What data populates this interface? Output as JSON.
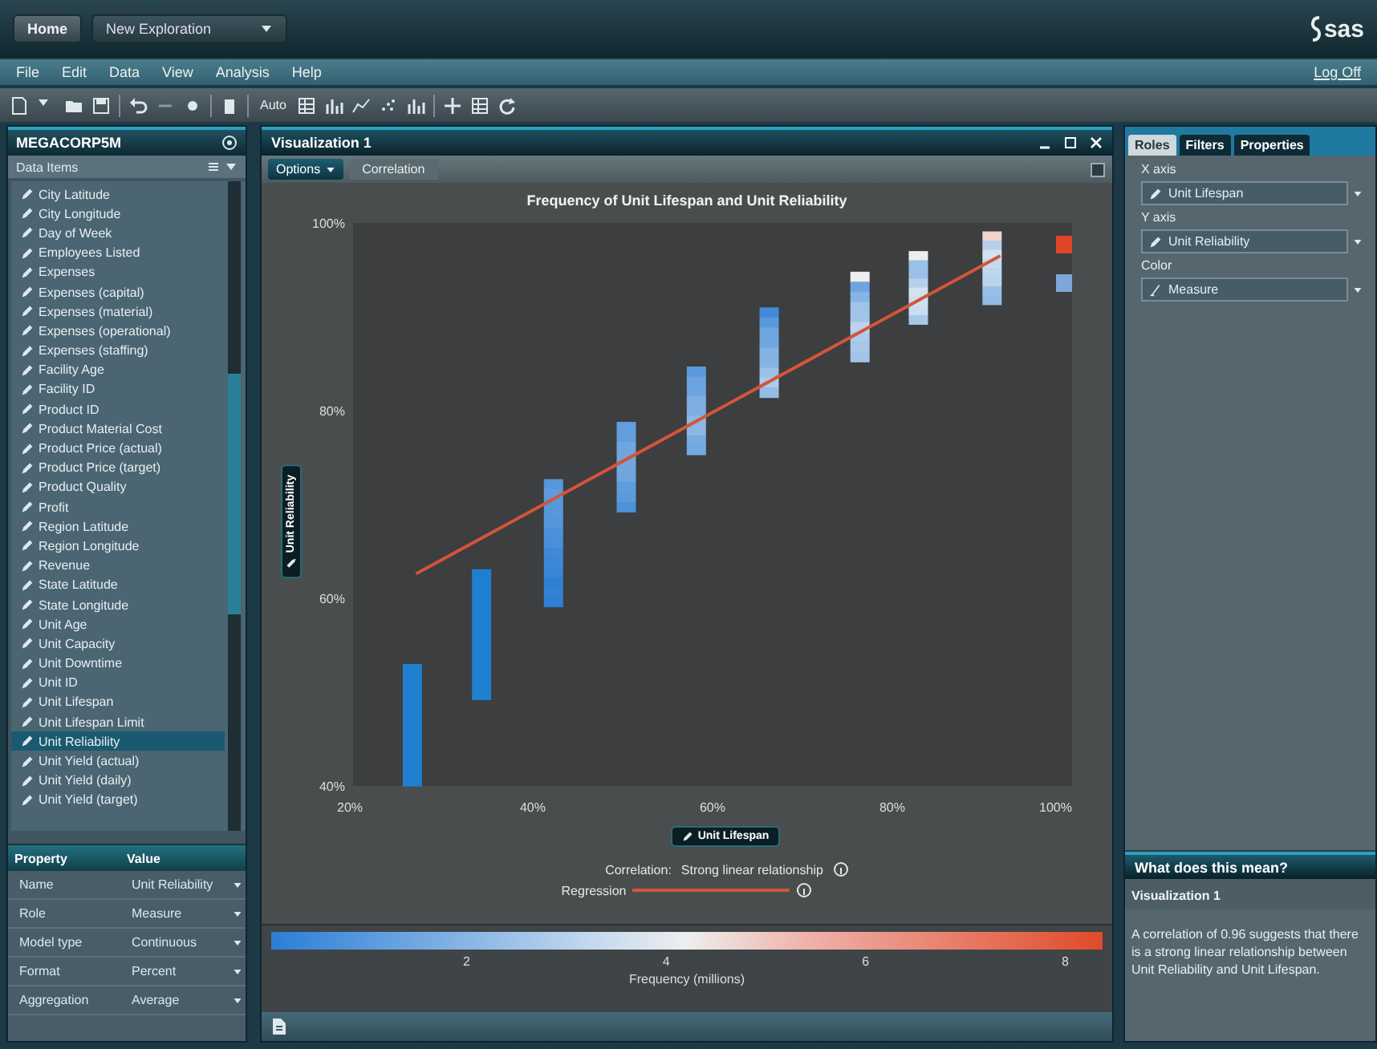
{
  "top_bar": {
    "home": "Home",
    "exploration": "New Exploration",
    "logo": "sas"
  },
  "menu": [
    {
      "label": "File"
    },
    {
      "label": "Edit"
    },
    {
      "label": "Data"
    },
    {
      "label": "View"
    },
    {
      "label": "Analysis"
    },
    {
      "label": "Help"
    }
  ],
  "log_off": "Log Off",
  "toolbar": {
    "auto_label": "Auto"
  },
  "data_panel": {
    "title": "MEGACORP5M",
    "section": "Data Items",
    "items": [
      {
        "label": "City Latitude",
        "selected": false
      },
      {
        "label": "City Longitude",
        "selected": false
      },
      {
        "label": "Day of Week",
        "selected": false
      },
      {
        "label": "Employees Listed",
        "selected": false
      },
      {
        "label": "Expenses",
        "selected": false
      },
      {
        "label": "Expenses (capital)",
        "selected": false
      },
      {
        "label": "Expenses (material)",
        "selected": false
      },
      {
        "label": "Expenses (operational)",
        "selected": false
      },
      {
        "label": "Expenses (staffing)",
        "selected": false
      },
      {
        "label": "Facility Age",
        "selected": false
      },
      {
        "label": "Facility ID",
        "selected": false
      },
      {
        "label": "Product ID",
        "selected": false
      },
      {
        "label": "Product Material Cost",
        "selected": false
      },
      {
        "label": "Product Price (actual)",
        "selected": false
      },
      {
        "label": "Product Price (target)",
        "selected": false
      },
      {
        "label": "Product Quality",
        "selected": false
      },
      {
        "label": "Profit",
        "selected": false
      },
      {
        "label": "Region Latitude",
        "selected": false
      },
      {
        "label": "Region Longitude",
        "selected": false
      },
      {
        "label": "Revenue",
        "selected": false
      },
      {
        "label": "State Latitude",
        "selected": false
      },
      {
        "label": "State Longitude",
        "selected": false
      },
      {
        "label": "Unit Age",
        "selected": false
      },
      {
        "label": "Unit Capacity",
        "selected": false
      },
      {
        "label": "Unit Downtime",
        "selected": false
      },
      {
        "label": "Unit ID",
        "selected": false
      },
      {
        "label": "Unit Lifespan",
        "selected": false
      },
      {
        "label": "Unit Lifespan Limit",
        "selected": false
      },
      {
        "label": "Unit Reliability",
        "selected": true
      },
      {
        "label": "Unit Yield (actual)",
        "selected": false
      },
      {
        "label": "Unit Yield (daily)",
        "selected": false
      },
      {
        "label": "Unit Yield (target)",
        "selected": false
      }
    ],
    "properties": {
      "columns": [
        "Property",
        "Value"
      ],
      "rows": [
        [
          "Name",
          "Unit Reliability"
        ],
        [
          "Role",
          "Measure"
        ],
        [
          "Model type",
          "Continuous"
        ],
        [
          "Format",
          "Percent"
        ],
        [
          "Aggregation",
          "Average"
        ]
      ]
    }
  },
  "visualization": {
    "title": "Visualization 1",
    "options": "Options",
    "view_tab": "Correlation",
    "chart_data": {
      "type": "line",
      "title": "Frequency of Unit Lifespan and Unit Reliability",
      "xlabel": "Unit Lifespan",
      "ylabel": "Unit Reliability",
      "x": [
        27,
        92
      ],
      "xlim": [
        20,
        100
      ],
      "ylim": [
        40,
        100
      ],
      "xticks": [
        {
          "value": 20,
          "label": "20%"
        },
        {
          "value": 40,
          "label": "40%"
        },
        {
          "value": 60,
          "label": "60%"
        },
        {
          "value": 80,
          "label": "80%"
        },
        {
          "value": 100,
          "label": "100%"
        }
      ],
      "yticks": [
        {
          "value": 40,
          "label": "40%"
        },
        {
          "value": 60,
          "label": "60%"
        },
        {
          "value": 80,
          "label": "80%"
        },
        {
          "value": 100,
          "label": "100%"
        }
      ],
      "series": [
        {
          "name": "Regression",
          "color": "#d2553a",
          "values": [
            62.6,
            96.5
          ]
        }
      ]
    },
    "legend_swatches": [
      {
        "color": "#e0452a"
      },
      {
        "color": "#7ea6d8"
      }
    ],
    "correlation": {
      "label": "Correlation:",
      "value": "Strong linear relationship"
    },
    "frequency_legend": {
      "ticks": [
        "2",
        "4",
        "6",
        "8"
      ],
      "title": "Frequency (millions)"
    }
  },
  "roles_panel": {
    "tabs": [
      {
        "label": "Roles",
        "selected": true
      },
      {
        "label": "Filters",
        "selected": false
      },
      {
        "label": "Properties",
        "selected": false
      }
    ],
    "roles": [
      {
        "label": "X axis",
        "value": "Unit Lifespan"
      },
      {
        "label": "Y axis",
        "value": "Unit Reliability"
      },
      {
        "label": "Color",
        "value": "Measure"
      }
    ],
    "help": {
      "title": "What does this mean?",
      "heading": "Visualization 1",
      "text": "A correlation of 0.96 suggests that there is a strong linear relationship between Unit Reliability and Unit Lifespan."
    }
  }
}
